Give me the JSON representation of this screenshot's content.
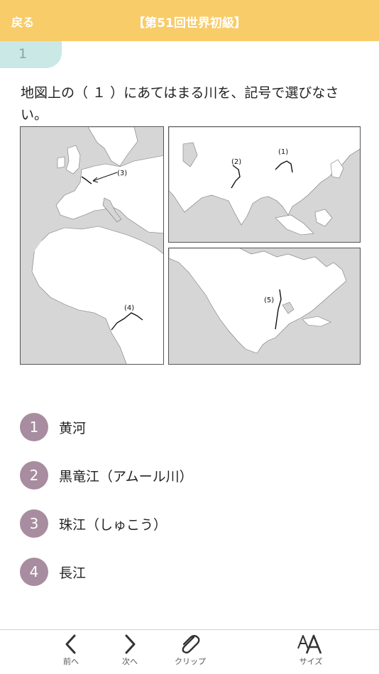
{
  "header": {
    "back_label": "戻る",
    "title": "【第51回世界初級】"
  },
  "question": {
    "number": "1",
    "text": "地図上の（ １ ）にあてはまる川を、記号で選びなさい。"
  },
  "maps": {
    "europe_africa": {
      "labels": [
        "(3)",
        "(4)"
      ]
    },
    "asia": {
      "labels": [
        "(1)",
        "(2)"
      ]
    },
    "north_america": {
      "labels": [
        "(5)"
      ]
    }
  },
  "options": [
    {
      "number": "1",
      "label": "黄河"
    },
    {
      "number": "2",
      "label": "黒竜江（アムール川）"
    },
    {
      "number": "3",
      "label": "珠江（しゅこう）"
    },
    {
      "number": "4",
      "label": "長江"
    }
  ],
  "footer": {
    "prev_label": "前へ",
    "next_label": "次へ",
    "clip_label": "クリップ",
    "size_label": "サイズ"
  },
  "colors": {
    "header": "#f8cc69",
    "question_tab": "#c9e8e6",
    "option_circle": "#a78d9f",
    "map_sea": "#d6d6d6"
  },
  "icons": {
    "prev": "chevron-left-icon",
    "next": "chevron-right-icon",
    "clip": "paperclip-icon",
    "size": "text-size-icon"
  }
}
